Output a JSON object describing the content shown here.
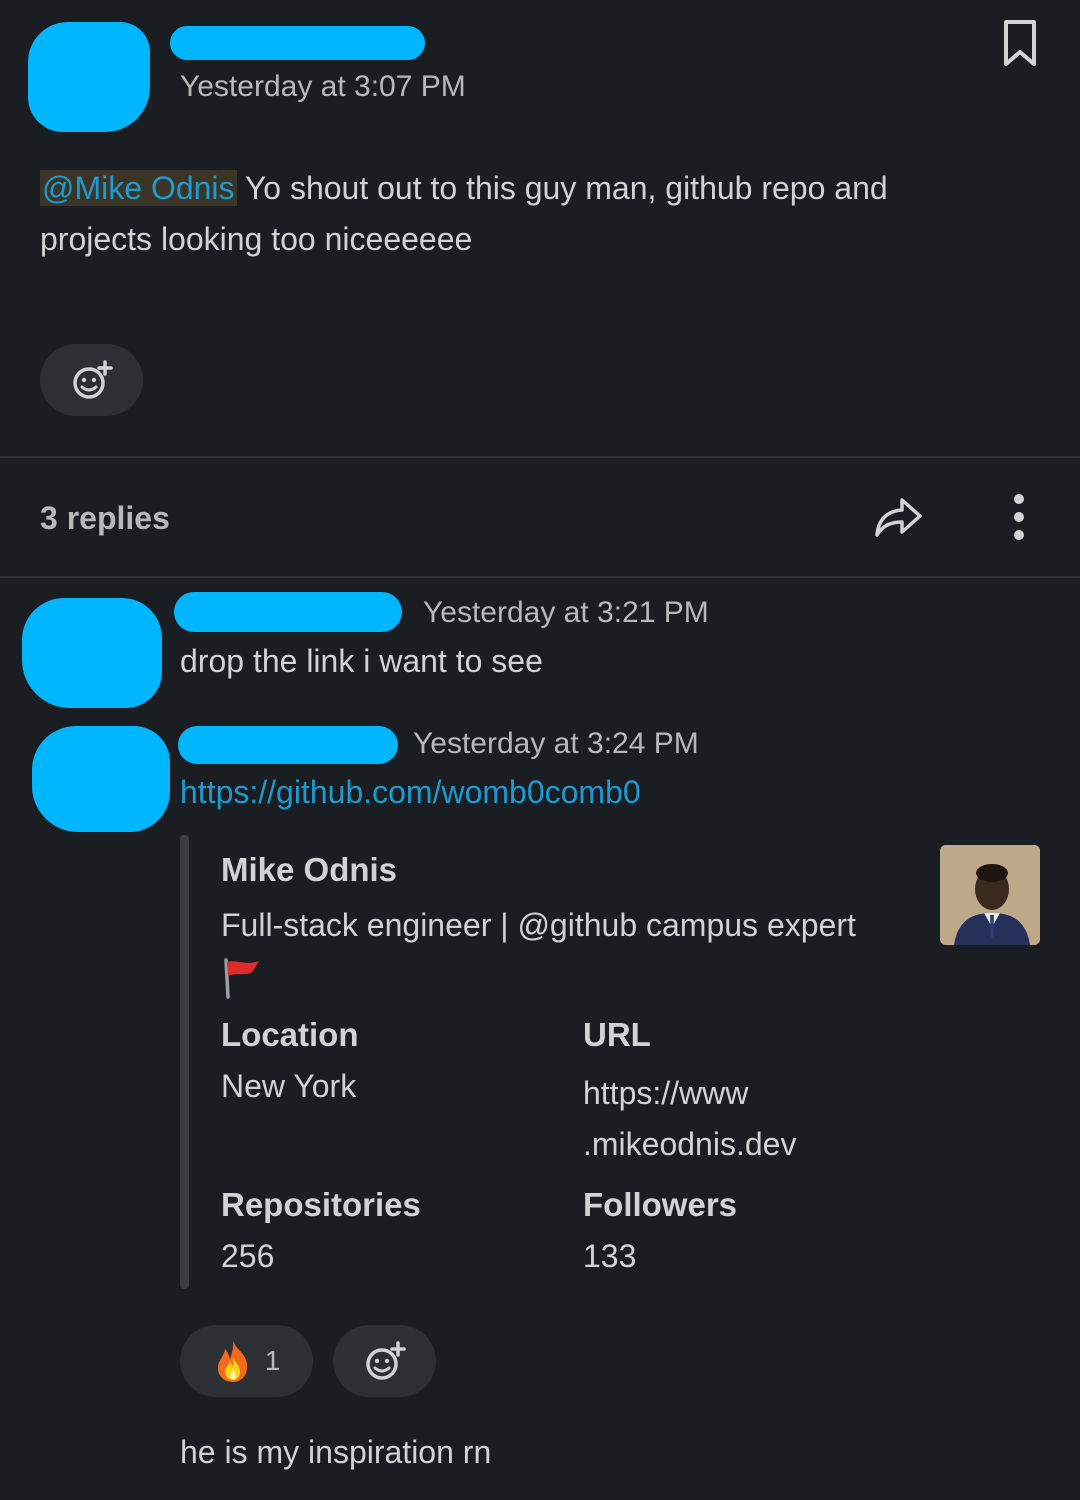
{
  "post": {
    "timestamp": "Yesterday at 3:07 PM",
    "mention": "@Mike Odnis",
    "body_line1": " Yo shout out to this guy man, github repo and",
    "body_line2": "projects looking too niceeeeee"
  },
  "thread": {
    "replies_label": "3 replies"
  },
  "replies": [
    {
      "timestamp": "Yesterday at 3:21 PM",
      "text": "drop the link i want to see"
    },
    {
      "timestamp": "Yesterday at 3:24 PM",
      "link": "https://github.com/womb0comb0"
    }
  ],
  "unfurl": {
    "name": "Mike Odnis",
    "bio": "Full-stack engineer | @github campus expert",
    "bio_emoji": "🚩",
    "fields": {
      "location_label": "Location",
      "location_value": "New York",
      "url_label": "URL",
      "url_line1": "https://www",
      "url_line2": ".mikeodnis.dev",
      "repos_label": "Repositories",
      "repos_value": "256",
      "followers_label": "Followers",
      "followers_value": "133"
    }
  },
  "reaction": {
    "emoji": "🔥",
    "count": "1"
  },
  "last_reply": {
    "text": "he is my inspiration rn"
  },
  "icons": [
    "bookmark-icon",
    "add-reaction-icon",
    "share-icon",
    "more-options-icon",
    "fire-emoji"
  ],
  "colors": {
    "background": "#1a1d21",
    "link": "#1d9bd1",
    "redaction": "#00b7ff"
  }
}
